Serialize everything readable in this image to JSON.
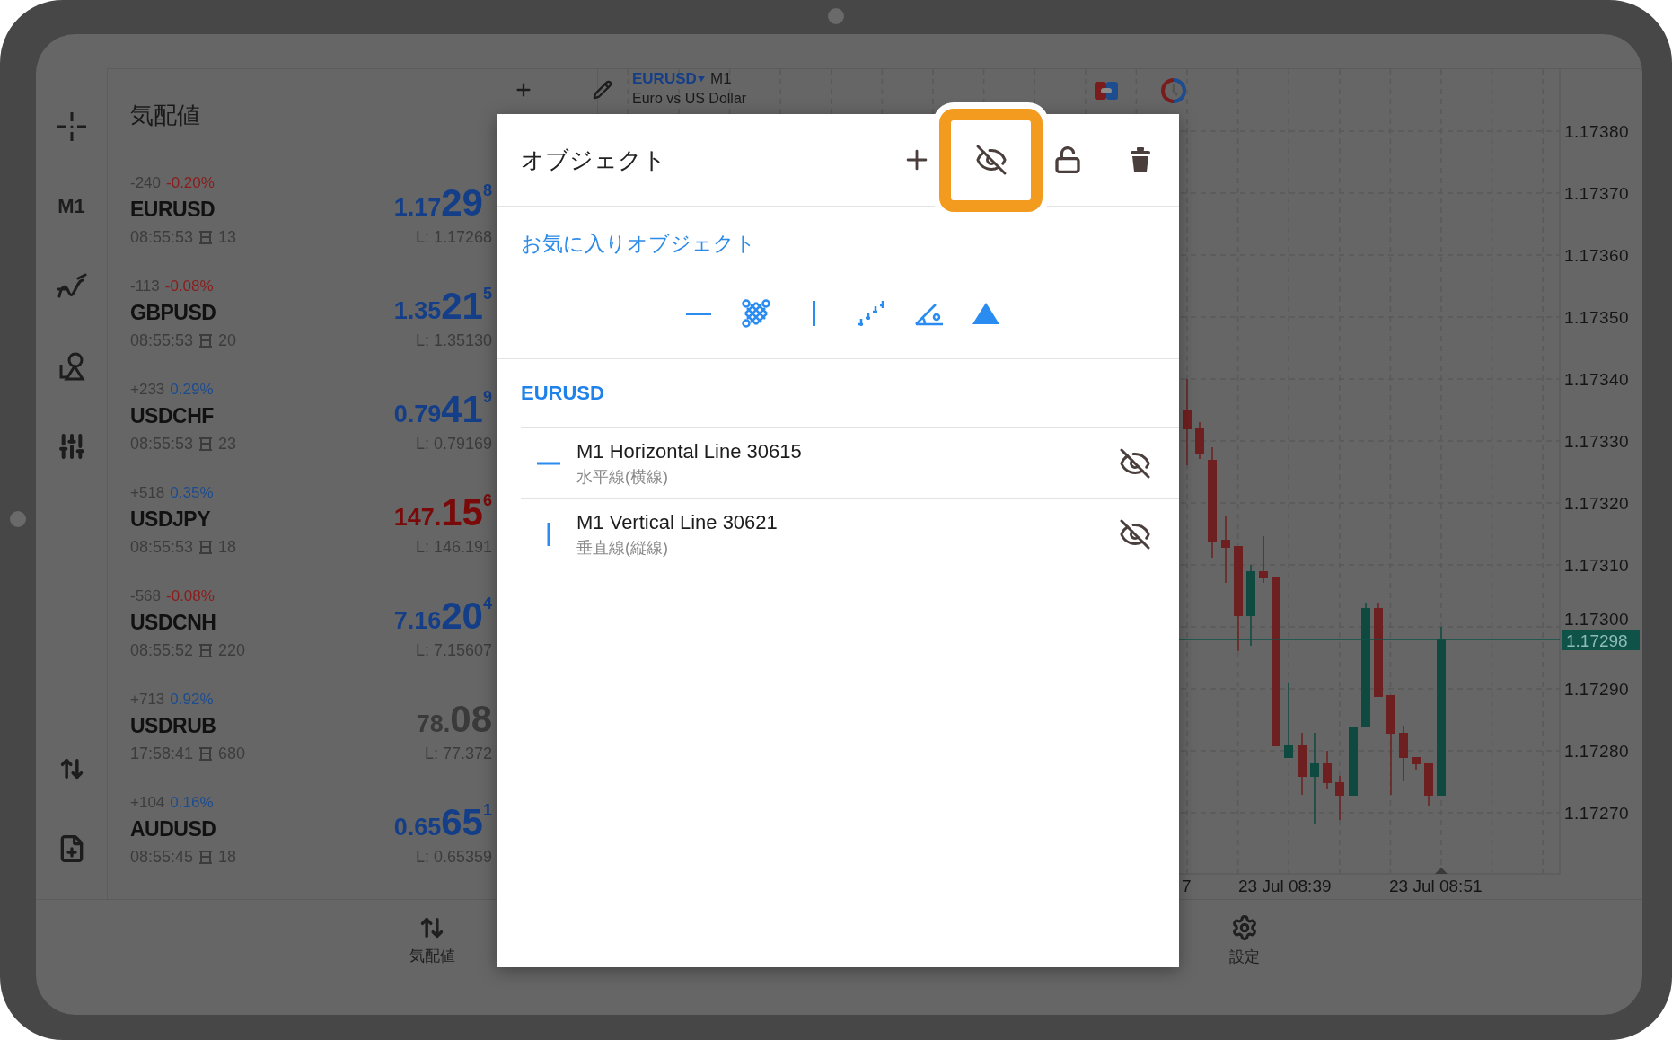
{
  "toolbar": {
    "timeframe": "M1"
  },
  "market_watch": {
    "title": "気配値",
    "symbols": [
      {
        "symbol": "EURUSD",
        "change": {
          "points": "-240",
          "percent": "-0.20%",
          "color": "#8c1c1c"
        },
        "time": "08:55:53",
        "spread": "13",
        "price": {
          "lead": "1.17",
          "big": "29",
          "sup": "8",
          "color": "#143f88"
        },
        "low": "L: 1.17268"
      },
      {
        "symbol": "GBPUSD",
        "change": {
          "points": "-113",
          "percent": "-0.08%",
          "color": "#8c1c1c"
        },
        "time": "08:55:53",
        "spread": "20",
        "price": {
          "lead": "1.35",
          "big": "21",
          "sup": "5",
          "color": "#143f88"
        },
        "low": "L: 1.35130"
      },
      {
        "symbol": "USDCHF",
        "change": {
          "points": "+233",
          "percent": "0.29%",
          "color": "#1d4c8f"
        },
        "time": "08:55:53",
        "spread": "23",
        "price": {
          "lead": "0.79",
          "big": "41",
          "sup": "9",
          "color": "#143f88"
        },
        "low": "L: 0.79169"
      },
      {
        "symbol": "USDJPY",
        "change": {
          "points": "+518",
          "percent": "0.35%",
          "color": "#1d4c8f"
        },
        "time": "08:55:53",
        "spread": "18",
        "price": {
          "lead": "147.",
          "big": "15",
          "sup": "6",
          "color": "#7a0a0a"
        },
        "low": "L: 146.191"
      },
      {
        "symbol": "USDCNH",
        "change": {
          "points": "-568",
          "percent": "-0.08%",
          "color": "#8c1c1c"
        },
        "time": "08:55:52",
        "spread": "220",
        "price": {
          "lead": "7.16",
          "big": "20",
          "sup": "4",
          "color": "#143f88"
        },
        "low": "L: 7.15607"
      },
      {
        "symbol": "USDRUB",
        "change": {
          "points": "+713",
          "percent": "0.92%",
          "color": "#1d4c8f"
        },
        "time": "17:58:41",
        "spread": "680",
        "price": {
          "lead": "78.",
          "big": "08",
          "color": "#3a3a3a"
        },
        "low": "L: 77.372"
      },
      {
        "symbol": "AUDUSD",
        "change": {
          "points": "+104",
          "percent": "0.16%",
          "color": "#1d4c8f"
        },
        "time": "08:55:45",
        "spread": "18",
        "price": {
          "lead": "0.65",
          "big": "65",
          "sup": "1",
          "color": "#143f88"
        },
        "low": "L: 0.65359"
      }
    ]
  },
  "chart": {
    "symbol": "EURUSD",
    "timeframe": "M1",
    "description": "Euro vs US Dollar",
    "price_labels": [
      "1.17380",
      "1.17370",
      "1.17360",
      "1.17350",
      "1.17340",
      "1.17330",
      "1.17320",
      "1.17310",
      "1.17300",
      "1.17290",
      "1.17280",
      "1.17270"
    ],
    "current_price": "1.17298",
    "time_labels": [
      "7",
      "23 Jul 08:39",
      "23 Jul 08:51"
    ]
  },
  "bottom_nav": [
    {
      "kind": "quotes",
      "label": "気配値"
    },
    {
      "kind": "settings",
      "label": "設定"
    }
  ],
  "dialog": {
    "title": "オブジェクト",
    "favorites_link": "お気に入りオブジェクト",
    "group": "EURUSD",
    "objects": [
      {
        "kind": "horizontal",
        "name": "M1 Horizontal Line 30615",
        "type": "水平線(横線)"
      },
      {
        "kind": "vertical",
        "name": "M1 Vertical Line 30621",
        "type": "垂直線(縦線)"
      }
    ]
  }
}
